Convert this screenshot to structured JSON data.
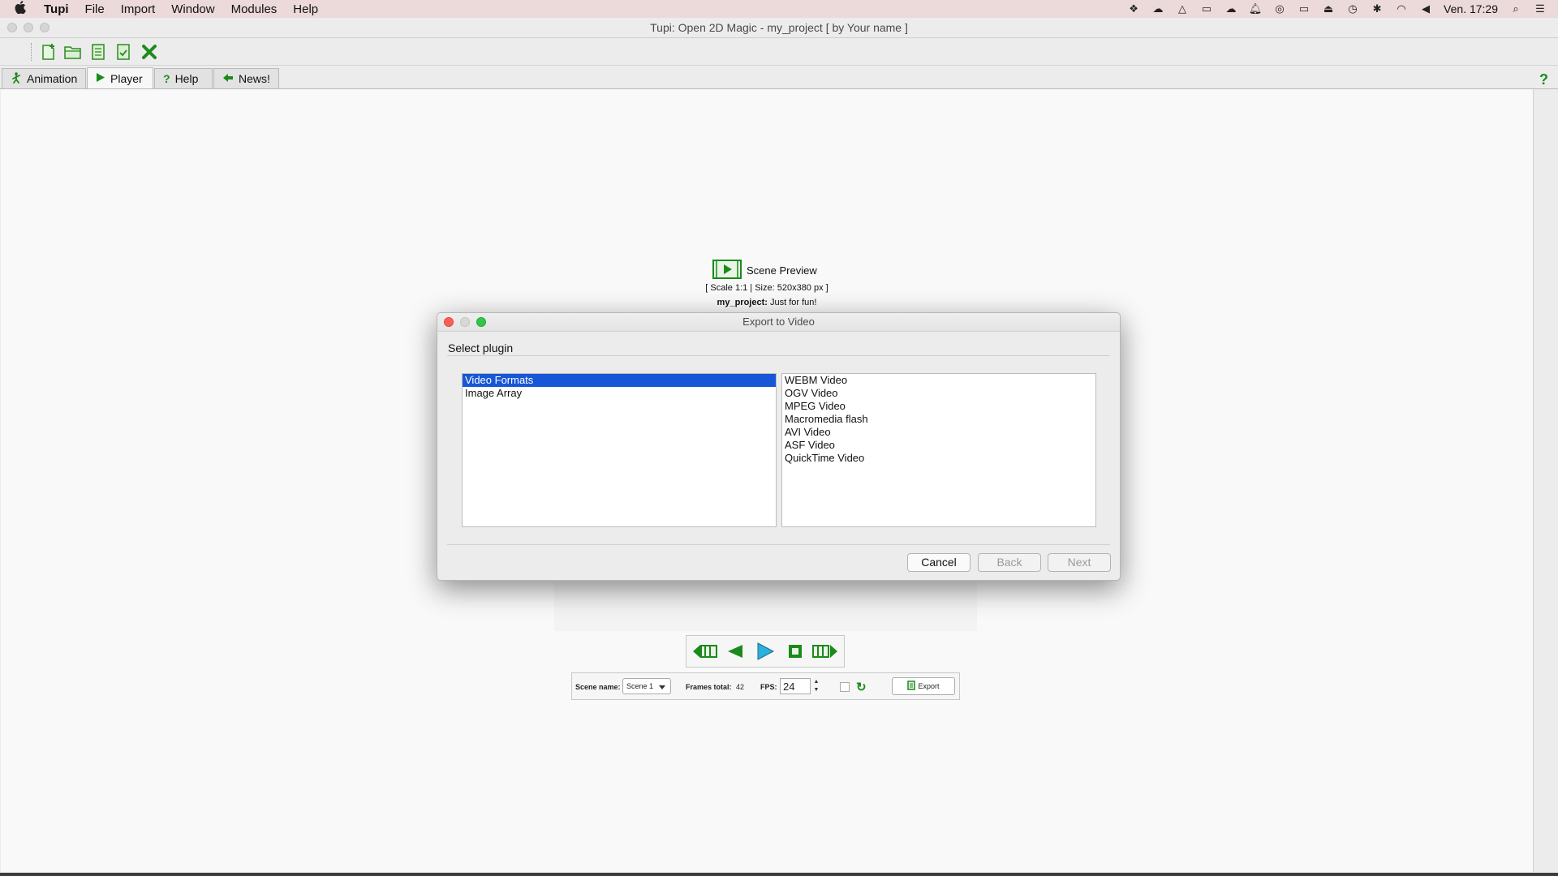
{
  "menubar": {
    "app": "Tupi",
    "items": [
      "File",
      "Import",
      "Window",
      "Modules",
      "Help"
    ],
    "clock": "Ven. 17:29"
  },
  "window": {
    "title": "Tupi: Open 2D Magic - my_project [ by Your name ]"
  },
  "toolbar": {
    "icons": [
      "new-document-icon",
      "open-folder-icon",
      "save-icon",
      "save-as-icon",
      "close-project-icon"
    ]
  },
  "tabs": [
    {
      "label": "Animation",
      "icon": "animation-icon"
    },
    {
      "label": "Player",
      "icon": "play-icon"
    },
    {
      "label": "Help",
      "icon": "question-icon"
    },
    {
      "label": "News!",
      "icon": "news-icon"
    }
  ],
  "preview": {
    "title": "Scene Preview",
    "info": "[ Scale 1:1 | Size: 520x380 px ]",
    "project_name": "my_project:",
    "project_desc": "Just for fun!"
  },
  "status": {
    "scene_label": "Scene name:",
    "scene_value": "Scene 1",
    "frames_label": "Frames total:",
    "frames_value": "42",
    "fps_label": "FPS:",
    "fps_value": "24",
    "export_label": "Export"
  },
  "dialog": {
    "title": "Export to Video",
    "section": "Select plugin",
    "plugins": [
      "Video Formats",
      "Image Array"
    ],
    "selected_plugin": 0,
    "formats": [
      "WEBM Video",
      "OGV Video",
      "MPEG Video",
      "Macromedia flash",
      "AVI Video",
      "ASF Video",
      "QuickTime Video"
    ],
    "buttons": {
      "cancel": "Cancel",
      "back": "Back",
      "next": "Next"
    }
  },
  "colors": {
    "accent_green": "#1a8a1a",
    "selection_blue": "#1756d6",
    "menubar_bg": "#ecd9da"
  }
}
